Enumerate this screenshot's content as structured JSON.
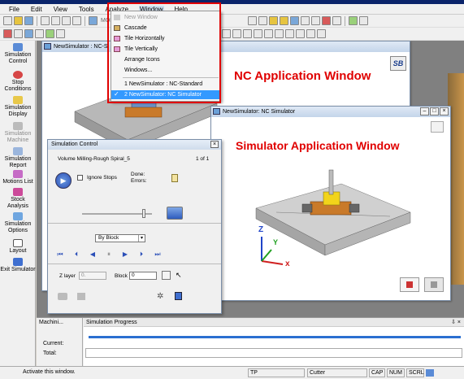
{
  "menubar": {
    "items": [
      "File",
      "Edit",
      "View",
      "Tools",
      "Analyze",
      "Window",
      "Help"
    ],
    "active": "Window"
  },
  "toolbar": {
    "model_label": "MODEL"
  },
  "sidebar": {
    "items": [
      {
        "label": "Simulation Control",
        "icon": "play-control-icon"
      },
      {
        "label": "Stop Conditions",
        "icon": "stop-icon"
      },
      {
        "label": "Simulation Display",
        "icon": "display-icon"
      },
      {
        "label": "Simulation Machine",
        "icon": "machine-icon"
      },
      {
        "label": "Simulation Report",
        "icon": "report-icon"
      },
      {
        "label": "Motions List",
        "icon": "list-icon"
      },
      {
        "label": "Stock Analysis",
        "icon": "stock-icon"
      },
      {
        "label": "Simulation Options",
        "icon": "options-icon"
      },
      {
        "label": "Layout",
        "icon": "layout-icon"
      },
      {
        "label": "Exit Simulator",
        "icon": "exit-icon"
      }
    ]
  },
  "window_menu": {
    "items": [
      {
        "label": "New Window",
        "disabled": true
      },
      {
        "label": "Cascade"
      },
      {
        "label": "Tile Horizontally"
      },
      {
        "label": "Tile Vertically"
      },
      {
        "label": "Arrange Icons"
      },
      {
        "label": "Windows..."
      },
      {
        "label": "1 NewSimulator : NC-Standard"
      },
      {
        "label": "2 NewSimulator: NC Simulator",
        "selected": true
      }
    ]
  },
  "nc_window": {
    "title": "NewSimulator : NC-S",
    "annotation": "NC Application Window",
    "logo": "SB"
  },
  "sim_window": {
    "title": "NewSimulator: NC Simulator",
    "annotation": "Simulator Application Window",
    "axis_z": "Z",
    "axis_y": "Y",
    "axis_x": "x"
  },
  "simulation_control": {
    "title": "Simulation Control",
    "close": "×",
    "operation": "Volume Milling-Rough Spiral_5",
    "counter": "1 of 1",
    "ignore_stops": "Ignore Stops",
    "done_label": "Done:",
    "errors_label": "Errors:",
    "mode_value": "By Block",
    "z_layer_label": "Z layer",
    "z_layer_value": "0.",
    "block_label": "Block",
    "block_value": "0"
  },
  "bottom_panel": {
    "left_tab": "Machini...",
    "right_title": "Simulation Progress",
    "current_label": "Current:",
    "total_label": "Total:",
    "pin": "⇩ ×"
  },
  "status_bar": {
    "message": "Activate this window.",
    "tp": "TP",
    "cutter": "Cutter",
    "cap": "CAP",
    "num": "NUM",
    "scrl": "SCRL"
  },
  "colors": {
    "annotation_red": "#e00000",
    "highlight_blue": "#3399ff",
    "part_orange": "#c97a2a",
    "tool_yellow": "#f2d41a",
    "progress_blue": "#2b6fd1"
  }
}
